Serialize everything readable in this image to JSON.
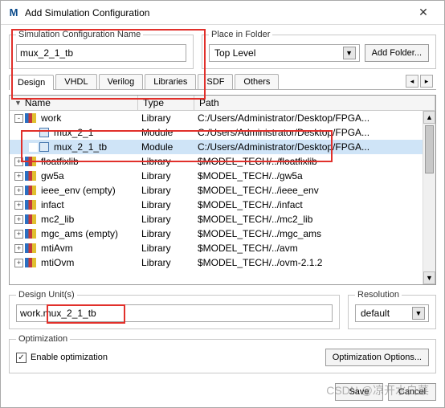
{
  "window": {
    "title": "Add Simulation Configuration",
    "icon_letter": "M"
  },
  "sim_name": {
    "legend": "Simulation Configuration Name",
    "value": "mux_2_1_tb"
  },
  "folder": {
    "legend": "Place in Folder",
    "selected": "Top Level",
    "add_button": "Add Folder..."
  },
  "tabs": [
    "Design",
    "VHDL",
    "Verilog",
    "Libraries",
    "SDF",
    "Others"
  ],
  "tree": {
    "headers": {
      "name": "Name",
      "type": "Type",
      "path": "Path"
    },
    "rows": [
      {
        "indent": 0,
        "toggle": "-",
        "icon": "lib",
        "name": "work",
        "type": "Library",
        "path": "C:/Users/Administrator/Desktop/FPGA...",
        "selected": false
      },
      {
        "indent": 1,
        "toggle": "",
        "icon": "mod",
        "name": "mux_2_1",
        "type": "Module",
        "path": "C:/Users/Administrator/Desktop/FPGA...",
        "selected": false
      },
      {
        "indent": 1,
        "toggle": "",
        "icon": "mod",
        "name": "mux_2_1_tb",
        "type": "Module",
        "path": "C:/Users/Administrator/Desktop/FPGA...",
        "selected": true
      },
      {
        "indent": 0,
        "toggle": "+",
        "icon": "lib",
        "name": "floatfixlib",
        "type": "Library",
        "path": "$MODEL_TECH/../floatfixlib",
        "selected": false
      },
      {
        "indent": 0,
        "toggle": "+",
        "icon": "lib",
        "name": "gw5a",
        "type": "Library",
        "path": "$MODEL_TECH/../gw5a",
        "selected": false
      },
      {
        "indent": 0,
        "toggle": "+",
        "icon": "lib",
        "name": "ieee_env (empty)",
        "type": "Library",
        "path": "$MODEL_TECH/../ieee_env",
        "selected": false
      },
      {
        "indent": 0,
        "toggle": "+",
        "icon": "lib",
        "name": "infact",
        "type": "Library",
        "path": "$MODEL_TECH/../infact",
        "selected": false
      },
      {
        "indent": 0,
        "toggle": "+",
        "icon": "lib",
        "name": "mc2_lib",
        "type": "Library",
        "path": "$MODEL_TECH/../mc2_lib",
        "selected": false
      },
      {
        "indent": 0,
        "toggle": "+",
        "icon": "lib",
        "name": "mgc_ams (empty)",
        "type": "Library",
        "path": "$MODEL_TECH/../mgc_ams",
        "selected": false
      },
      {
        "indent": 0,
        "toggle": "+",
        "icon": "lib",
        "name": "mtiAvm",
        "type": "Library",
        "path": "$MODEL_TECH/../avm",
        "selected": false
      },
      {
        "indent": 0,
        "toggle": "+",
        "icon": "lib",
        "name": "mtiOvm",
        "type": "Library",
        "path": "$MODEL_TECH/../ovm-2.1.2",
        "selected": false
      }
    ]
  },
  "design_unit": {
    "legend": "Design Unit(s)",
    "value": "work.mux_2_1_tb"
  },
  "resolution": {
    "legend": "Resolution",
    "selected": "default"
  },
  "optimization": {
    "legend": "Optimization",
    "enable_label": "Enable optimization",
    "enabled": true,
    "options_button": "Optimization Options..."
  },
  "footer": {
    "save": "Save",
    "cancel": "Cancel"
  },
  "watermark": "CSDN @凉开水白菜"
}
